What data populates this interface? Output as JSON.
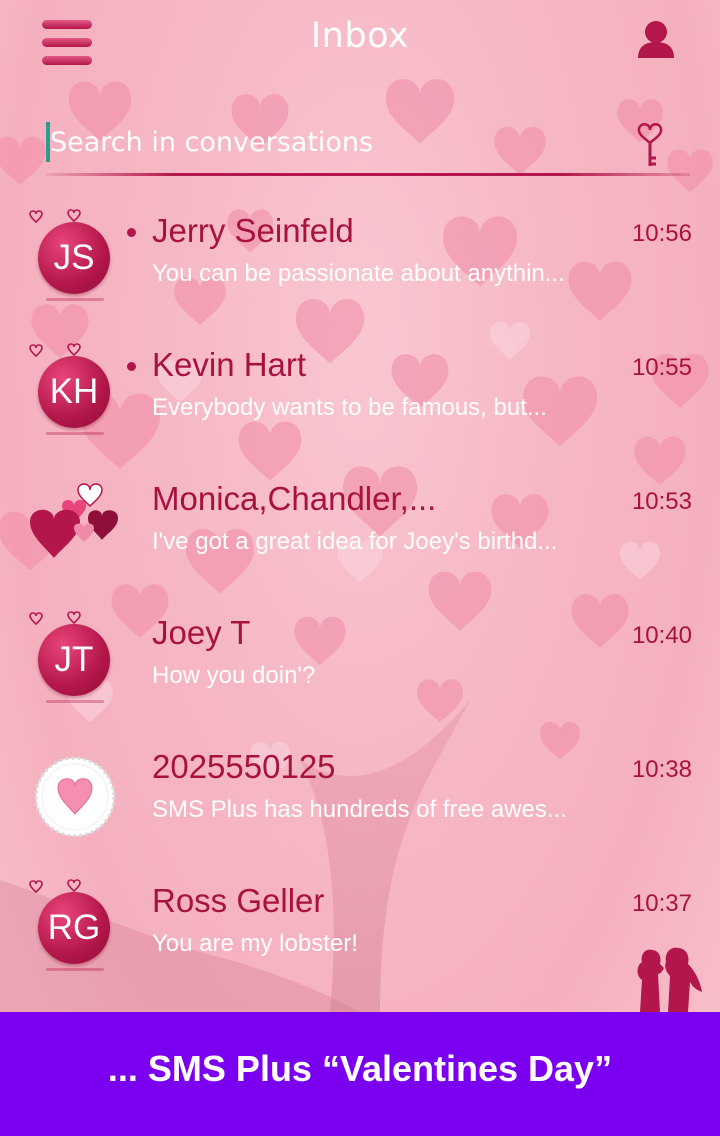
{
  "header": {
    "title": "Inbox",
    "menu_icon": "hamburger-menu-icon",
    "profile_icon": "user-profile-icon"
  },
  "search": {
    "placeholder": "Search in conversations",
    "icon": "heart-key-icon"
  },
  "conversations": [
    {
      "initials": "JS",
      "name": "Jerry Seinfeld",
      "time": "10:56",
      "preview": "You can be passionate about anythin...",
      "unread": true,
      "avatar_type": "initials"
    },
    {
      "initials": "KH",
      "name": "Kevin Hart",
      "time": "10:55",
      "preview": "Everybody wants to be famous, but...",
      "unread": true,
      "avatar_type": "initials"
    },
    {
      "initials": "",
      "name": "Monica,Chandler,...",
      "time": "10:53",
      "preview": "I've got a great idea for Joey's birthd...",
      "unread": false,
      "avatar_type": "group-hearts"
    },
    {
      "initials": "JT",
      "name": "Joey T",
      "time": "10:40",
      "preview": "How you doin'?",
      "unread": false,
      "avatar_type": "initials"
    },
    {
      "initials": "",
      "name": "2025550125",
      "time": "10:38",
      "preview": "SMS Plus has hundreds of free awes...",
      "unread": false,
      "avatar_type": "heart-frame"
    },
    {
      "initials": "RG",
      "name": "Ross Geller",
      "time": "10:37",
      "preview": "You are my lobster!",
      "unread": false,
      "avatar_type": "initials"
    }
  ],
  "banner": {
    "text": "... SMS Plus “Valentines Day”"
  },
  "colors": {
    "accent": "#b3164a",
    "name_text": "#a8123f",
    "banner_bg": "#7c00f0",
    "background": "#f6b7c4"
  }
}
